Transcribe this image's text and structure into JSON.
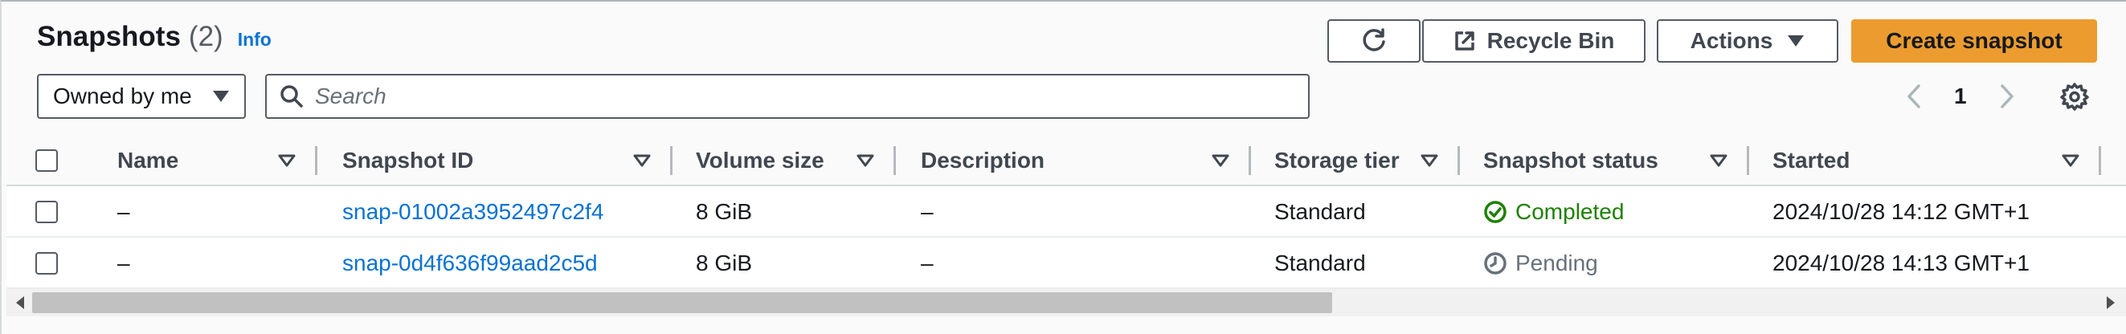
{
  "header": {
    "title": "Snapshots",
    "count": "(2)",
    "info_link": "Info"
  },
  "toolbar": {
    "refresh_icon": "refresh-icon",
    "recycle_bin_label": "Recycle Bin",
    "actions_label": "Actions",
    "create_label": "Create snapshot",
    "create_color": "#ec9c2f"
  },
  "filter": {
    "owner_select_value": "Owned by me",
    "search_placeholder": "Search"
  },
  "pagination": {
    "current_page": "1"
  },
  "table": {
    "columns": [
      "Name",
      "Snapshot ID",
      "Volume size",
      "Description",
      "Storage tier",
      "Snapshot status",
      "Started"
    ],
    "rows": [
      {
        "name": "–",
        "snapshot_id": "snap-01002a3952497c2f4",
        "volume_size": "8 GiB",
        "description": "–",
        "storage_tier": "Standard",
        "status": "Completed",
        "status_color": "#1d8102",
        "started": "2024/10/28 14:12 GMT+1"
      },
      {
        "name": "–",
        "snapshot_id": "snap-0d4f636f99aad2c5d",
        "volume_size": "8 GiB",
        "description": "–",
        "storage_tier": "Standard",
        "status": "Pending",
        "status_color": "#687078",
        "started": "2024/10/28 14:13 GMT+1"
      }
    ]
  },
  "colors": {
    "link": "#0972d3",
    "primary_button": "#ec9c2f"
  }
}
